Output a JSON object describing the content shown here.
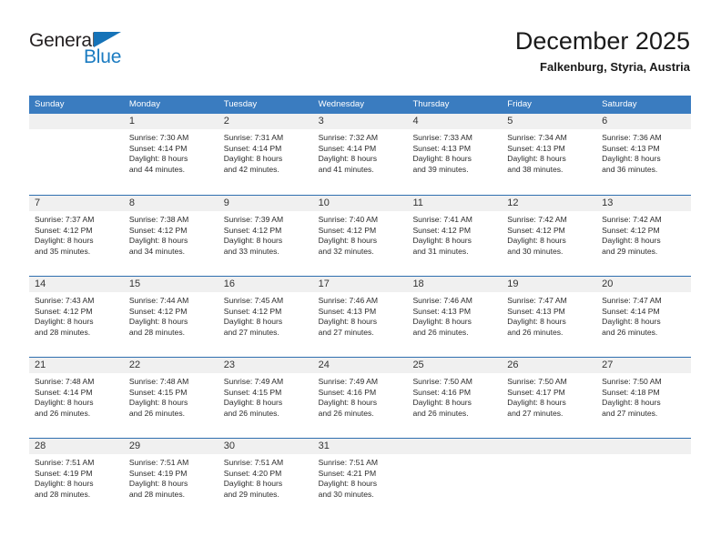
{
  "brand": {
    "name_part1": "General",
    "name_part2": "Blue",
    "triangle_icon": "triangle-icon",
    "color_dark": "#231f20",
    "color_blue": "#1a7bc1"
  },
  "header": {
    "title": "December 2025",
    "subtitle": "Falkenburg, Styria, Austria"
  },
  "calendar": {
    "accent_color": "#3a7cc0",
    "row_border_color": "#2f6faf",
    "day_band_color": "#f0f0f0",
    "weekdays": [
      "Sunday",
      "Monday",
      "Tuesday",
      "Wednesday",
      "Thursday",
      "Friday",
      "Saturday"
    ],
    "weeks": [
      [
        {
          "day": "",
          "lines": []
        },
        {
          "day": "1",
          "lines": [
            "Sunrise: 7:30 AM",
            "Sunset: 4:14 PM",
            "Daylight: 8 hours",
            "and 44 minutes."
          ]
        },
        {
          "day": "2",
          "lines": [
            "Sunrise: 7:31 AM",
            "Sunset: 4:14 PM",
            "Daylight: 8 hours",
            "and 42 minutes."
          ]
        },
        {
          "day": "3",
          "lines": [
            "Sunrise: 7:32 AM",
            "Sunset: 4:14 PM",
            "Daylight: 8 hours",
            "and 41 minutes."
          ]
        },
        {
          "day": "4",
          "lines": [
            "Sunrise: 7:33 AM",
            "Sunset: 4:13 PM",
            "Daylight: 8 hours",
            "and 39 minutes."
          ]
        },
        {
          "day": "5",
          "lines": [
            "Sunrise: 7:34 AM",
            "Sunset: 4:13 PM",
            "Daylight: 8 hours",
            "and 38 minutes."
          ]
        },
        {
          "day": "6",
          "lines": [
            "Sunrise: 7:36 AM",
            "Sunset: 4:13 PM",
            "Daylight: 8 hours",
            "and 36 minutes."
          ]
        }
      ],
      [
        {
          "day": "7",
          "lines": [
            "Sunrise: 7:37 AM",
            "Sunset: 4:12 PM",
            "Daylight: 8 hours",
            "and 35 minutes."
          ]
        },
        {
          "day": "8",
          "lines": [
            "Sunrise: 7:38 AM",
            "Sunset: 4:12 PM",
            "Daylight: 8 hours",
            "and 34 minutes."
          ]
        },
        {
          "day": "9",
          "lines": [
            "Sunrise: 7:39 AM",
            "Sunset: 4:12 PM",
            "Daylight: 8 hours",
            "and 33 minutes."
          ]
        },
        {
          "day": "10",
          "lines": [
            "Sunrise: 7:40 AM",
            "Sunset: 4:12 PM",
            "Daylight: 8 hours",
            "and 32 minutes."
          ]
        },
        {
          "day": "11",
          "lines": [
            "Sunrise: 7:41 AM",
            "Sunset: 4:12 PM",
            "Daylight: 8 hours",
            "and 31 minutes."
          ]
        },
        {
          "day": "12",
          "lines": [
            "Sunrise: 7:42 AM",
            "Sunset: 4:12 PM",
            "Daylight: 8 hours",
            "and 30 minutes."
          ]
        },
        {
          "day": "13",
          "lines": [
            "Sunrise: 7:42 AM",
            "Sunset: 4:12 PM",
            "Daylight: 8 hours",
            "and 29 minutes."
          ]
        }
      ],
      [
        {
          "day": "14",
          "lines": [
            "Sunrise: 7:43 AM",
            "Sunset: 4:12 PM",
            "Daylight: 8 hours",
            "and 28 minutes."
          ]
        },
        {
          "day": "15",
          "lines": [
            "Sunrise: 7:44 AM",
            "Sunset: 4:12 PM",
            "Daylight: 8 hours",
            "and 28 minutes."
          ]
        },
        {
          "day": "16",
          "lines": [
            "Sunrise: 7:45 AM",
            "Sunset: 4:12 PM",
            "Daylight: 8 hours",
            "and 27 minutes."
          ]
        },
        {
          "day": "17",
          "lines": [
            "Sunrise: 7:46 AM",
            "Sunset: 4:13 PM",
            "Daylight: 8 hours",
            "and 27 minutes."
          ]
        },
        {
          "day": "18",
          "lines": [
            "Sunrise: 7:46 AM",
            "Sunset: 4:13 PM",
            "Daylight: 8 hours",
            "and 26 minutes."
          ]
        },
        {
          "day": "19",
          "lines": [
            "Sunrise: 7:47 AM",
            "Sunset: 4:13 PM",
            "Daylight: 8 hours",
            "and 26 minutes."
          ]
        },
        {
          "day": "20",
          "lines": [
            "Sunrise: 7:47 AM",
            "Sunset: 4:14 PM",
            "Daylight: 8 hours",
            "and 26 minutes."
          ]
        }
      ],
      [
        {
          "day": "21",
          "lines": [
            "Sunrise: 7:48 AM",
            "Sunset: 4:14 PM",
            "Daylight: 8 hours",
            "and 26 minutes."
          ]
        },
        {
          "day": "22",
          "lines": [
            "Sunrise: 7:48 AM",
            "Sunset: 4:15 PM",
            "Daylight: 8 hours",
            "and 26 minutes."
          ]
        },
        {
          "day": "23",
          "lines": [
            "Sunrise: 7:49 AM",
            "Sunset: 4:15 PM",
            "Daylight: 8 hours",
            "and 26 minutes."
          ]
        },
        {
          "day": "24",
          "lines": [
            "Sunrise: 7:49 AM",
            "Sunset: 4:16 PM",
            "Daylight: 8 hours",
            "and 26 minutes."
          ]
        },
        {
          "day": "25",
          "lines": [
            "Sunrise: 7:50 AM",
            "Sunset: 4:16 PM",
            "Daylight: 8 hours",
            "and 26 minutes."
          ]
        },
        {
          "day": "26",
          "lines": [
            "Sunrise: 7:50 AM",
            "Sunset: 4:17 PM",
            "Daylight: 8 hours",
            "and 27 minutes."
          ]
        },
        {
          "day": "27",
          "lines": [
            "Sunrise: 7:50 AM",
            "Sunset: 4:18 PM",
            "Daylight: 8 hours",
            "and 27 minutes."
          ]
        }
      ],
      [
        {
          "day": "28",
          "lines": [
            "Sunrise: 7:51 AM",
            "Sunset: 4:19 PM",
            "Daylight: 8 hours",
            "and 28 minutes."
          ]
        },
        {
          "day": "29",
          "lines": [
            "Sunrise: 7:51 AM",
            "Sunset: 4:19 PM",
            "Daylight: 8 hours",
            "and 28 minutes."
          ]
        },
        {
          "day": "30",
          "lines": [
            "Sunrise: 7:51 AM",
            "Sunset: 4:20 PM",
            "Daylight: 8 hours",
            "and 29 minutes."
          ]
        },
        {
          "day": "31",
          "lines": [
            "Sunrise: 7:51 AM",
            "Sunset: 4:21 PM",
            "Daylight: 8 hours",
            "and 30 minutes."
          ]
        },
        {
          "day": "",
          "lines": []
        },
        {
          "day": "",
          "lines": []
        },
        {
          "day": "",
          "lines": []
        }
      ]
    ]
  }
}
